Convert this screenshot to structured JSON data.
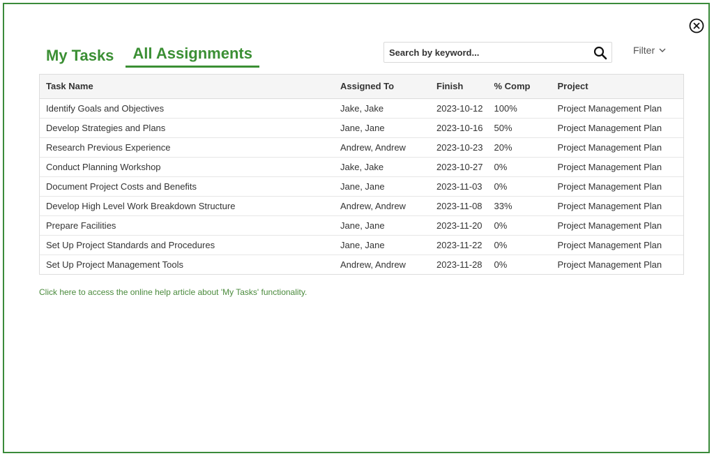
{
  "tabs": [
    {
      "label": "My Tasks",
      "active": false
    },
    {
      "label": "All Assignments",
      "active": true
    }
  ],
  "search": {
    "placeholder": "Search by keyword...",
    "icon": "search-icon"
  },
  "filter": {
    "label": "Filter",
    "icon": "chevron-down-icon"
  },
  "table": {
    "columns": [
      "Task Name",
      "Assigned To",
      "Finish",
      "% Comp",
      "Project"
    ],
    "rows": [
      [
        "Identify Goals and Objectives",
        "Jake, Jake",
        "2023-10-12",
        "100%",
        "Project Management Plan"
      ],
      [
        "Develop Strategies and Plans",
        "Jane, Jane",
        "2023-10-16",
        "50%",
        "Project Management Plan"
      ],
      [
        "Research Previous Experience",
        "Andrew, Andrew",
        "2023-10-23",
        "20%",
        "Project Management Plan"
      ],
      [
        "Conduct Planning Workshop",
        "Jake, Jake",
        "2023-10-27",
        "0%",
        "Project Management Plan"
      ],
      [
        "Document Project Costs and Benefits",
        "Jane, Jane",
        "2023-11-03",
        "0%",
        "Project Management Plan"
      ],
      [
        "Develop High Level Work Breakdown Structure",
        "Andrew, Andrew",
        "2023-11-08",
        "33%",
        "Project Management Plan"
      ],
      [
        "Prepare Facilities",
        "Jane, Jane",
        "2023-11-20",
        "0%",
        "Project Management Plan"
      ],
      [
        "Set Up Project Standards and Procedures",
        "Jane, Jane",
        "2023-11-22",
        "0%",
        "Project Management Plan"
      ],
      [
        "Set Up Project Management Tools",
        "Andrew, Andrew",
        "2023-11-28",
        "0%",
        "Project Management Plan"
      ]
    ]
  },
  "help_link": "Click here to access the online help article about 'My Tasks' functionality.",
  "colors": {
    "accent": "#3b8f34",
    "border": "#3a8a3a",
    "link": "#4a8a3c"
  }
}
